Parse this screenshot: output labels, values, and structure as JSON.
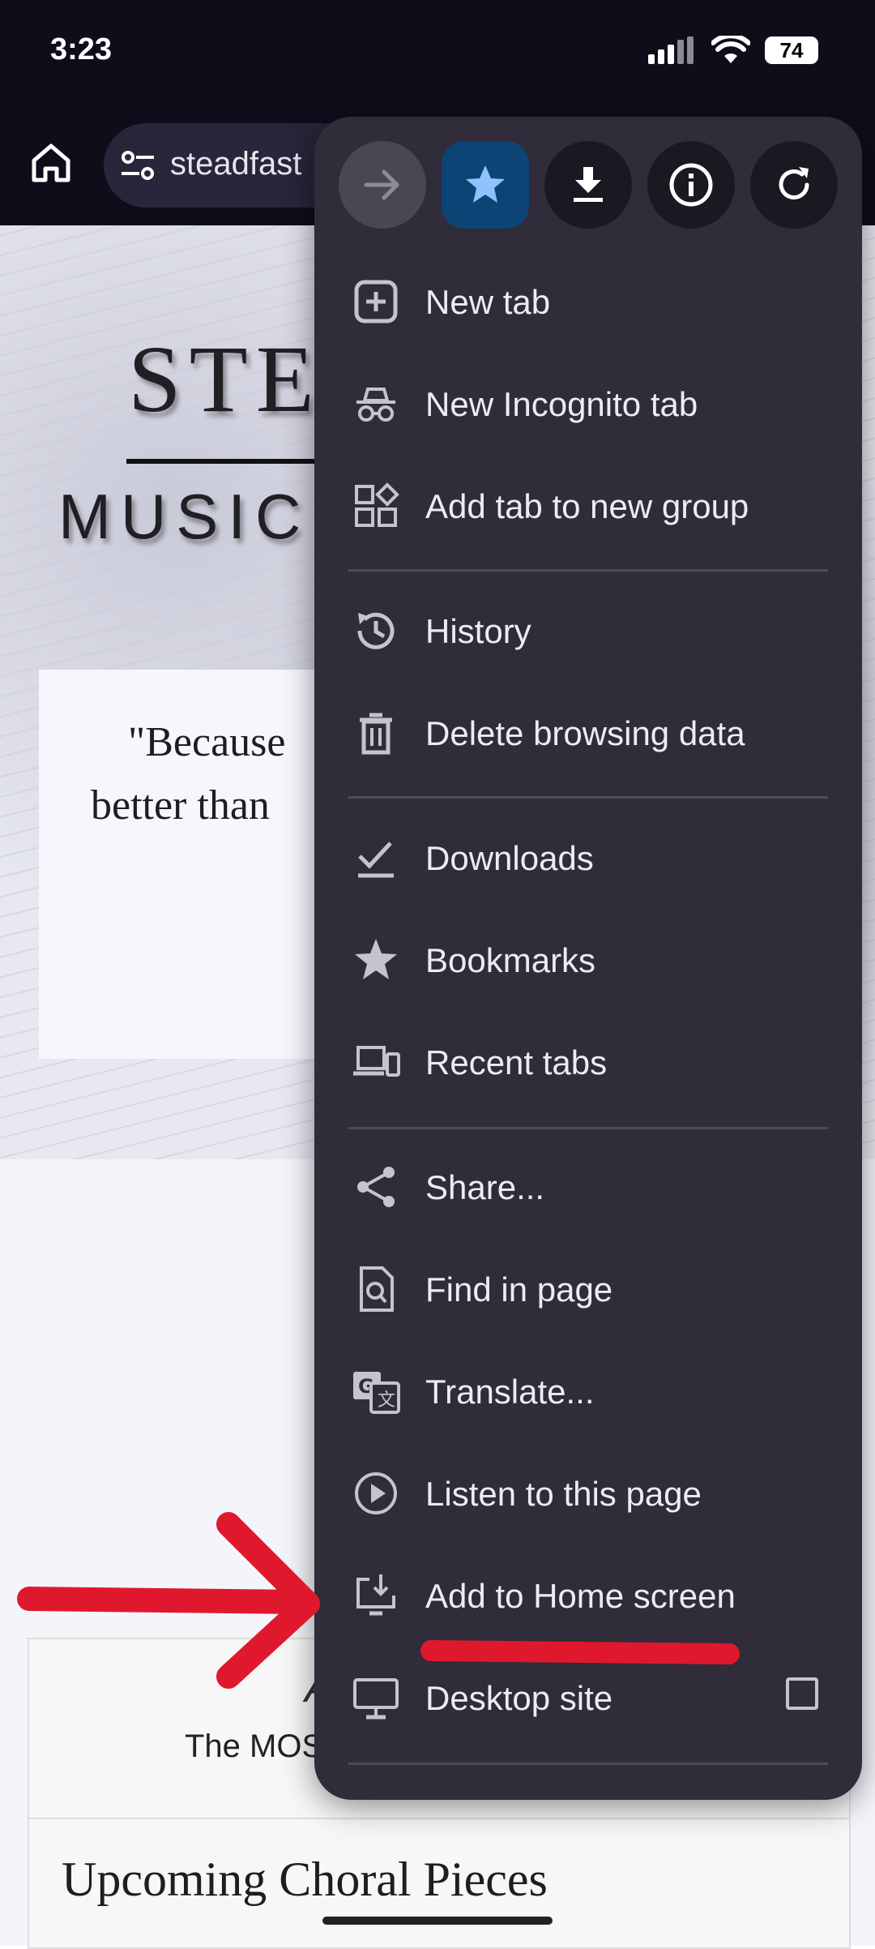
{
  "status_bar": {
    "time": "3:23",
    "battery": "74"
  },
  "toolbar": {
    "url": "steadfast"
  },
  "page": {
    "logo_title": "STE",
    "logo_subtitle": "MUSIC",
    "quote_line1": "\"Because",
    "quote_line2": "better than",
    "card_letter": "A",
    "card_line": "The MOS",
    "card_heading": "Upcoming Choral Pieces"
  },
  "menu": {
    "top_actions": [
      {
        "name": "forward",
        "icon": "arrow-right-icon"
      },
      {
        "name": "bookmark",
        "icon": "star-icon"
      },
      {
        "name": "download",
        "icon": "download-icon"
      },
      {
        "name": "page-info",
        "icon": "info-icon"
      },
      {
        "name": "reload",
        "icon": "reload-icon"
      }
    ],
    "items": [
      {
        "label": "New tab",
        "icon": "plus-box-icon"
      },
      {
        "label": "New Incognito tab",
        "icon": "incognito-icon"
      },
      {
        "label": "Add tab to new group",
        "icon": "tab-group-icon"
      },
      {
        "label": "History",
        "icon": "history-icon"
      },
      {
        "label": "Delete browsing data",
        "icon": "trash-icon"
      },
      {
        "label": "Downloads",
        "icon": "download-check-icon"
      },
      {
        "label": "Bookmarks",
        "icon": "star-icon"
      },
      {
        "label": "Recent tabs",
        "icon": "devices-icon"
      },
      {
        "label": "Share...",
        "icon": "share-icon"
      },
      {
        "label": "Find in page",
        "icon": "find-in-page-icon"
      },
      {
        "label": "Translate...",
        "icon": "translate-icon"
      },
      {
        "label": "Listen to this page",
        "icon": "play-circle-icon"
      },
      {
        "label": "Add to Home screen",
        "icon": "add-to-home-icon"
      },
      {
        "label": "Desktop site",
        "icon": "monitor-icon",
        "checkbox_checked": false
      }
    ]
  },
  "colors": {
    "menu_bg": "#302c39",
    "toolbar_bg": "#0e0d1a",
    "annotation_red": "#e0182d",
    "bookmark_active": "#0d4476"
  }
}
